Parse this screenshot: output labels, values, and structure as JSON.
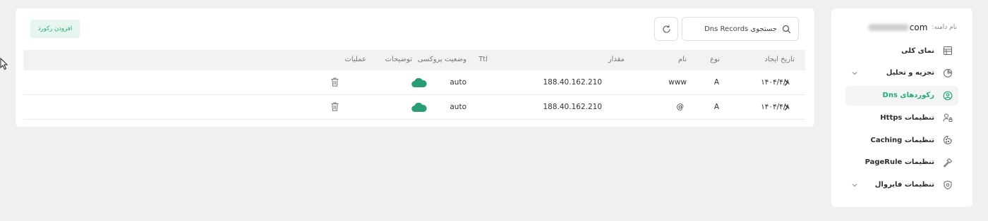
{
  "sidebar": {
    "domain_label": "نام دامنه:",
    "domain_suffix": "com",
    "items": [
      {
        "label": "نمای کلی",
        "icon": "table-icon"
      },
      {
        "label": "تجزیه و تحلیل",
        "icon": "pie-chart-icon",
        "expandable": true
      },
      {
        "label": "رکوردهای Dns",
        "icon": "dns-icon",
        "active": true
      },
      {
        "label": "تنظیمات Https",
        "icon": "user-lock-icon"
      },
      {
        "label": "تنظیمات Caching",
        "icon": "cookie-icon"
      },
      {
        "label": "تنظیمات PageRule",
        "icon": "hammer-icon"
      },
      {
        "label": "تنظیمات فایروال",
        "icon": "shield-icon",
        "expandable": true
      }
    ]
  },
  "toolbar": {
    "search_placeholder": "جستجوی Dns Records",
    "add_label": "افزودن رکورد"
  },
  "table": {
    "columns": {
      "created": "تاریخ ایجاد",
      "type": "نوع",
      "name": "نام",
      "value": "مقدار",
      "ttl": "Ttl",
      "proxy": "وضعیت پروکسی",
      "desc": "توضیحات",
      "actions": "عملیات"
    },
    "rows": [
      {
        "created": "۱۴۰۴/۴/۸",
        "type": "A",
        "name": "www",
        "value": "188.40.162.210",
        "ttl": "auto",
        "proxy": "on"
      },
      {
        "created": "۱۴۰۴/۴/۸",
        "type": "A",
        "name": "@",
        "value": "188.40.162.210",
        "ttl": "auto",
        "proxy": "on"
      }
    ]
  },
  "colors": {
    "accent": "#25a873",
    "cloud": "#2a9d72"
  }
}
